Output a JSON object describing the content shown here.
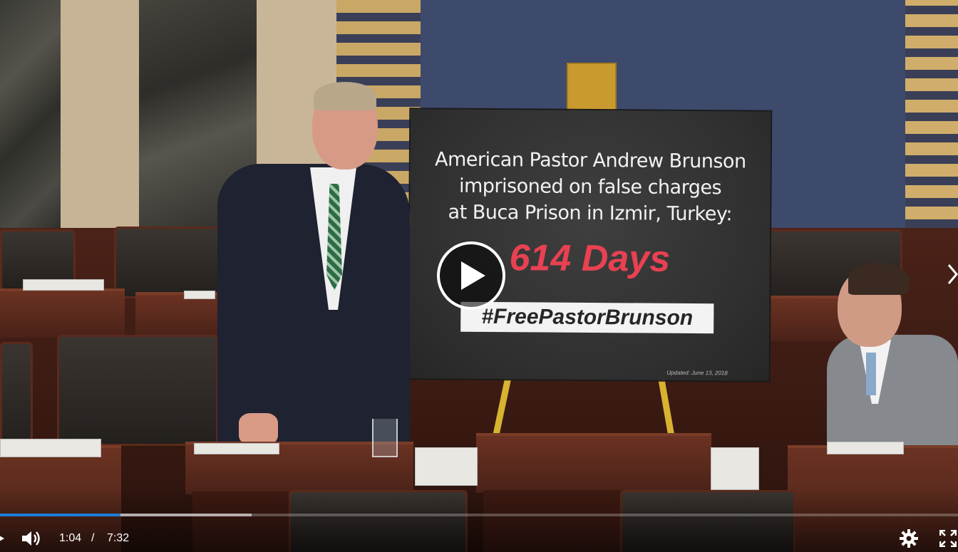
{
  "sign": {
    "line1": "American Pastor Andrew Brunson",
    "line2": "imprisoned on false charges",
    "line3": "at Buca Prison in Izmir, Turkey:",
    "days": "614 Days",
    "hashtag": "#FreePastorBrunson",
    "updated": "Updated: June 13, 2018"
  },
  "player": {
    "current_time": "1:04",
    "time_separator": "/",
    "duration": "7:32",
    "played_fraction": 0.126,
    "buffered_fraction": 0.263,
    "accent_color": "#1e7dd7",
    "icons": {
      "play": "play-icon",
      "volume": "volume-icon",
      "settings": "gear-icon",
      "fullscreen": "fullscreen-icon",
      "next": "chevron-right-icon"
    }
  }
}
